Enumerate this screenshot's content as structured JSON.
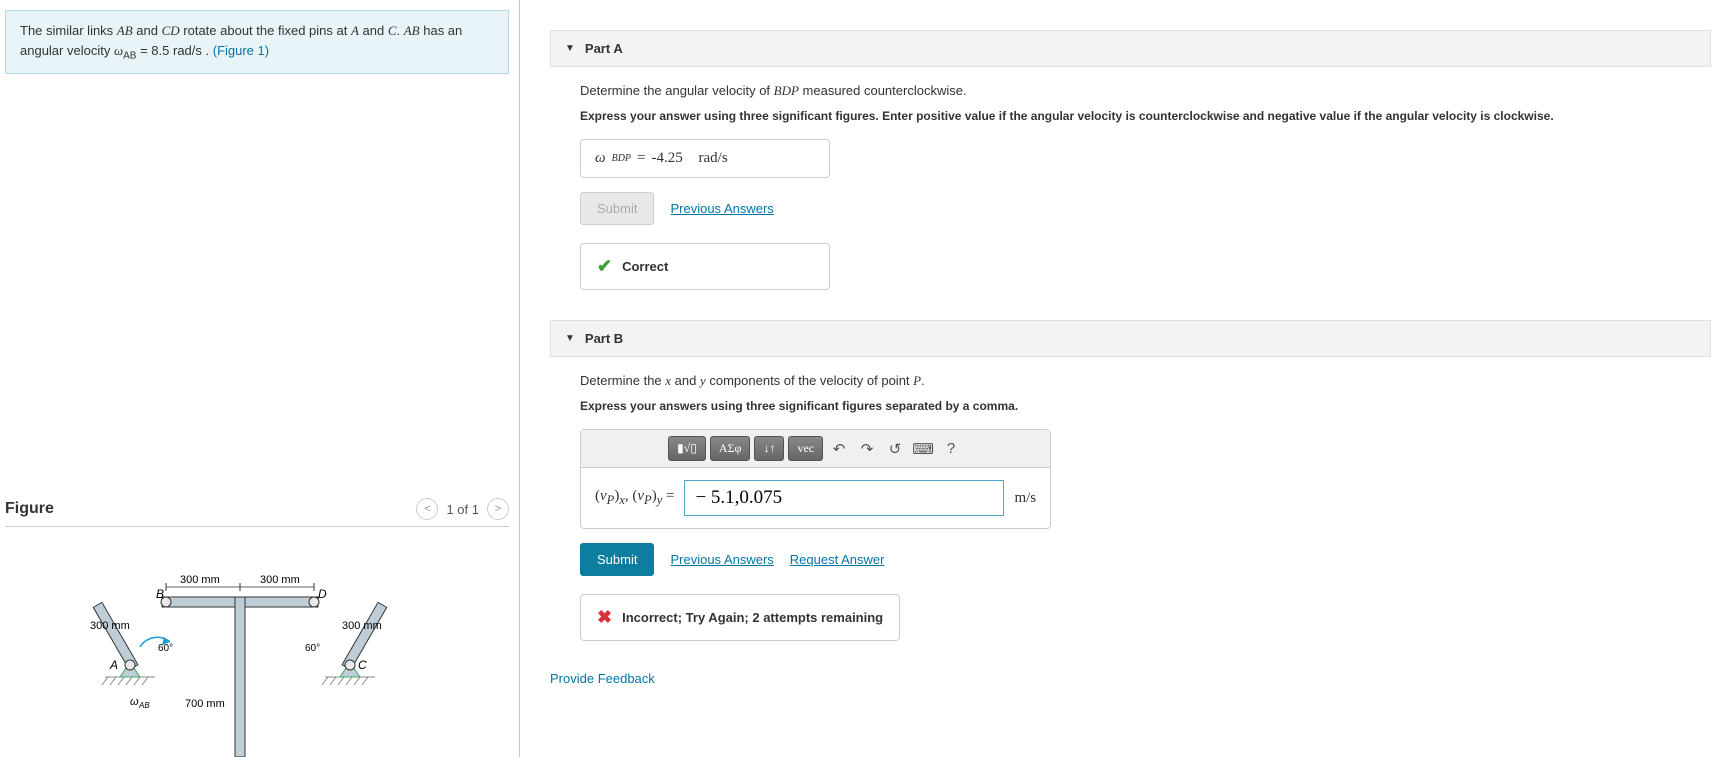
{
  "problem": {
    "text_prefix": "The similar links ",
    "link1": "AB",
    "text_mid1": " and ",
    "link2": "CD",
    "text_mid2": " rotate about the fixed pins at ",
    "pin1": "A",
    "text_mid3": " and ",
    "pin2": "C",
    "text_mid4": ". ",
    "link3": "AB",
    "text_mid5": " has an angular velocity ",
    "omega_var": "ω",
    "omega_sub": "AB",
    "eq": " = 8.5 ",
    "unit": "rad/s",
    "text_end": " . ",
    "fig_link": "(Figure 1)"
  },
  "figure": {
    "title": "Figure",
    "counter": "1 of 1",
    "dim_top1": "300 mm",
    "dim_top2": "300 mm",
    "dim_left": "300 mm",
    "dim_right": "300 mm",
    "dim_bottom": "700 mm",
    "angle1": "60°",
    "angle2": "60°",
    "labelA": "A",
    "labelB": "B",
    "labelC": "C",
    "labelD": "D",
    "omega_label": "ωAB"
  },
  "partA": {
    "title": "Part A",
    "prompt_prefix": "Determine the angular velocity of ",
    "prompt_var": "BDP",
    "prompt_suffix": " measured counterclockwise.",
    "instruction": "Express your answer using three significant figures. Enter positive value if the angular velocity is counterclockwise and negative value if the angular velocity is clockwise.",
    "ans_var": "ω",
    "ans_sub": "BDP",
    "ans_eq": " = ",
    "ans_val": "-4.25",
    "ans_unit": "rad/s",
    "submit": "Submit",
    "prev": "Previous Answers",
    "feedback": "Correct"
  },
  "partB": {
    "title": "Part B",
    "prompt_p1": "Determine the ",
    "prompt_x": "x",
    "prompt_p2": " and ",
    "prompt_y": "y",
    "prompt_p3": " components of the velocity of point ",
    "prompt_P": "P",
    "prompt_p4": ".",
    "instruction": "Express your answers using three significant figures separated by a comma.",
    "toolbar": {
      "t1": "▮√▯",
      "t2": "ΑΣφ",
      "t3": "↓↑",
      "t4": "vec"
    },
    "label_html": "(v_P)_x, (v_P)_y =",
    "input_value": "− 5.1,0.075",
    "unit": "m/s",
    "submit": "Submit",
    "prev": "Previous Answers",
    "req": "Request Answer",
    "feedback": "Incorrect; Try Again; 2 attempts remaining"
  },
  "feedback_link": "Provide Feedback"
}
